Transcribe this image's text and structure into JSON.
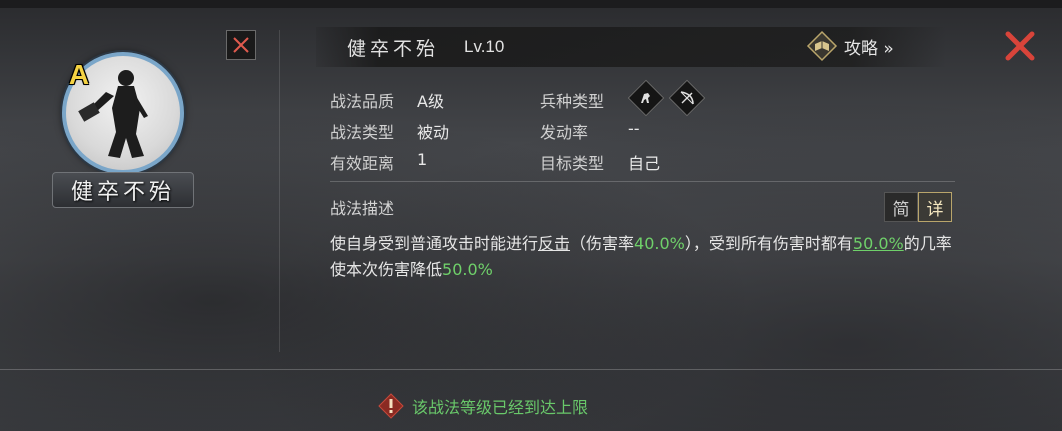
{
  "portrait": {
    "grade": "A",
    "name": "健卒不殆"
  },
  "header": {
    "skill_name": "健卒不殆",
    "level": "Lv.10",
    "guide_label": "攻略 »"
  },
  "attributes": {
    "quality_label": "战法品质",
    "quality_value": "A级",
    "type_label": "战法类型",
    "type_value": "被动",
    "range_label": "有效距离",
    "range_value": "1",
    "troop_label": "兵种类型",
    "trigger_label": "发动率",
    "trigger_value": "--",
    "target_label": "目标类型",
    "target_value": "自己"
  },
  "description": {
    "title": "战法描述",
    "mode_simple": "简",
    "mode_detail": "详",
    "text_a": "使自身受到普通攻击时能进行",
    "link_counter": "反击",
    "text_b": "（伤害率",
    "value_damage": "40.0%",
    "text_c": "），受到所有伤害时都有",
    "value_chance": "50.0%",
    "text_d": "的几率使本次伤害降低",
    "value_reduce": "50.0%"
  },
  "notice": {
    "text": "该战法等级已经到达上限"
  },
  "colors": {
    "highlight": "#6fd06a",
    "close_red": "#d8443a",
    "grade_gold": "#f5d343"
  }
}
